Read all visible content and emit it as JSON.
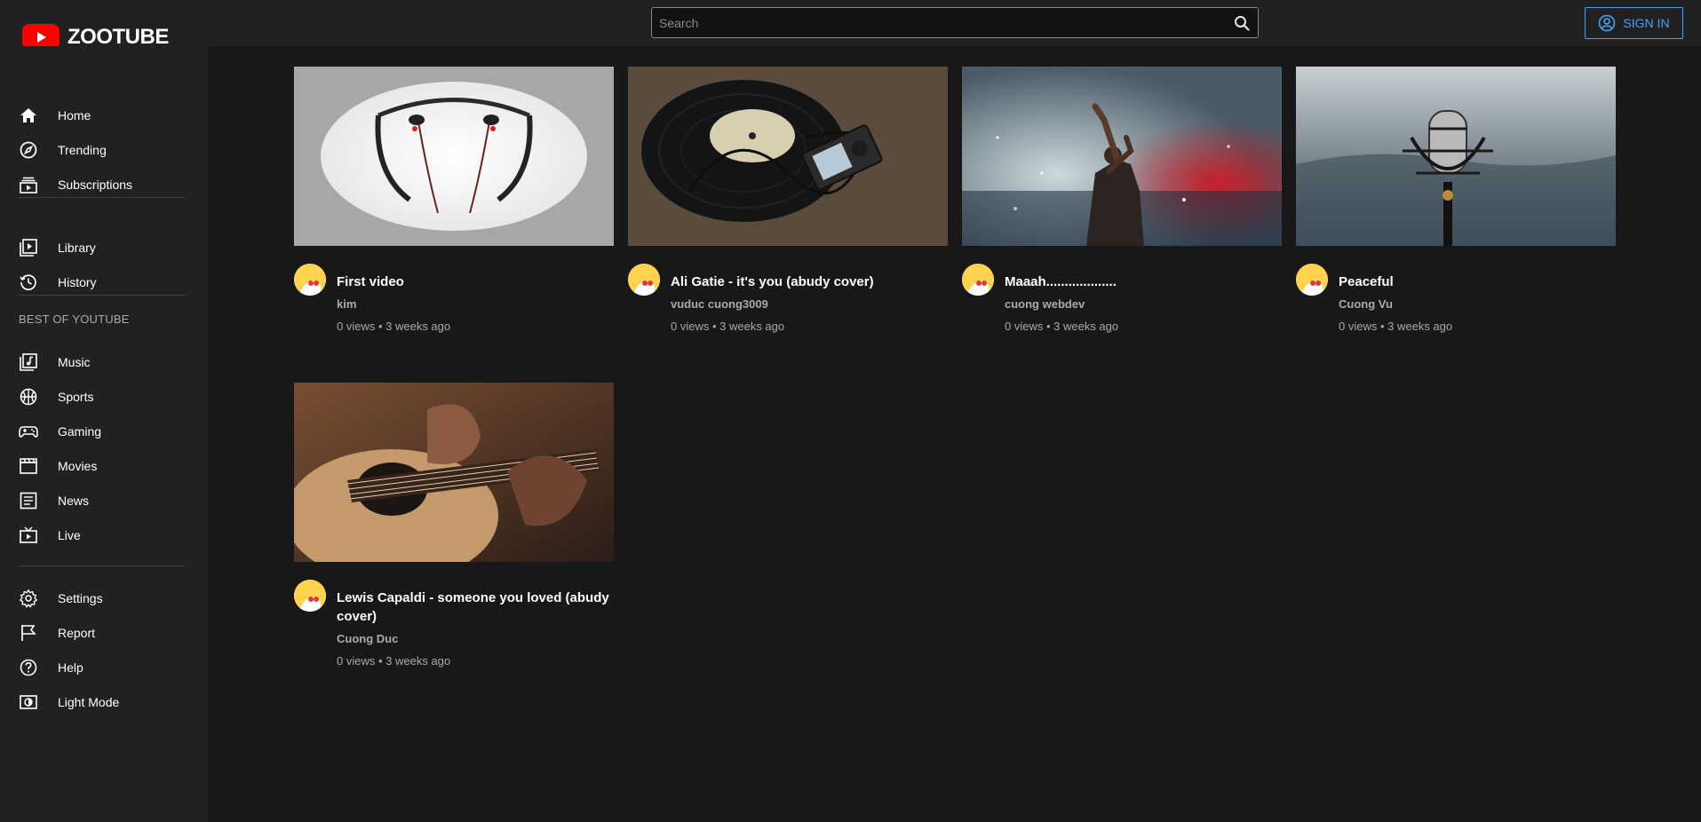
{
  "app": {
    "brand": "ZOOTUBE"
  },
  "search": {
    "placeholder": "Search"
  },
  "header": {
    "signin_label": "SIGN IN"
  },
  "sidebar": {
    "primary": [
      {
        "label": "Home",
        "icon": "home-icon"
      },
      {
        "label": "Trending",
        "icon": "compass-icon"
      },
      {
        "label": "Subscriptions",
        "icon": "subscriptions-icon"
      }
    ],
    "library": [
      {
        "label": "Library",
        "icon": "library-icon"
      },
      {
        "label": "History",
        "icon": "history-icon"
      }
    ],
    "best_title": "BEST OF YOUTUBE",
    "best": [
      {
        "label": "Music",
        "icon": "music-icon"
      },
      {
        "label": "Sports",
        "icon": "sports-icon"
      },
      {
        "label": "Gaming",
        "icon": "gamepad-icon"
      },
      {
        "label": "Movies",
        "icon": "movies-icon"
      },
      {
        "label": "News",
        "icon": "news-icon"
      },
      {
        "label": "Live",
        "icon": "live-tv-icon"
      }
    ],
    "footer": [
      {
        "label": "Settings",
        "icon": "gear-icon"
      },
      {
        "label": "Report",
        "icon": "flag-icon"
      },
      {
        "label": "Help",
        "icon": "help-icon"
      },
      {
        "label": "Light Mode",
        "icon": "contrast-icon"
      }
    ]
  },
  "videos": [
    {
      "title": "First video",
      "channel": "kim",
      "views": "0 views",
      "age": "3 weeks ago",
      "stats": "0 views • 3 weeks ago",
      "thumb": "earphones"
    },
    {
      "title": "Ali Gatie - it's you (abudy cover)",
      "channel": "vuduc cuong3009",
      "views": "0 views",
      "age": "3 weeks ago",
      "stats": "0 views • 3 weeks ago",
      "thumb": "vinyl-record"
    },
    {
      "title": "Maaah...................",
      "channel": "cuong webdev",
      "views": "0 views",
      "age": "3 weeks ago",
      "stats": "0 views • 3 weeks ago",
      "thumb": "concert-smoke"
    },
    {
      "title": "Peaceful",
      "channel": "Cuong Vu",
      "views": "0 views",
      "age": "3 weeks ago",
      "stats": "0 views • 3 weeks ago",
      "thumb": "microphone"
    },
    {
      "title": "Lewis Capaldi - someone you loved (abudy cover)",
      "channel": "Cuong Duc",
      "views": "0 views",
      "age": "3 weeks ago",
      "stats": "0 views • 3 weeks ago",
      "thumb": "guitar"
    }
  ],
  "colors": {
    "accent": "#3ea6ff",
    "brand": "#ff0000",
    "bg": "#181818",
    "panel": "#212121"
  }
}
